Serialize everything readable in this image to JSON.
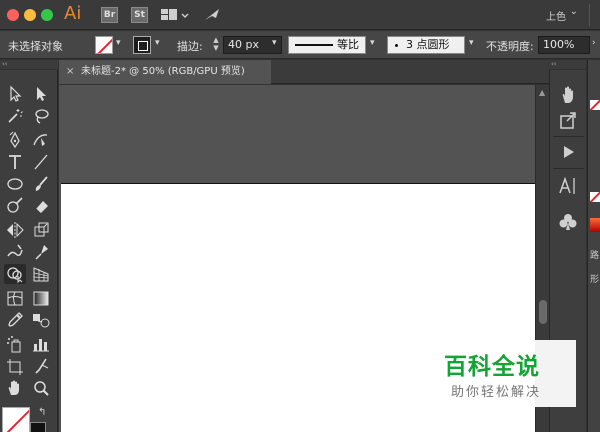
{
  "titlebar": {
    "app_logo": "Ai",
    "bridge_badge": "Br",
    "stock_badge": "St",
    "workspace": "上色",
    "workspace_chevron": "⌄"
  },
  "controlbar": {
    "selection_status": "未选择对象",
    "stroke_label": "描边:",
    "stroke_weight": "40 px",
    "stroke_profile": "等比",
    "brush": "3 点圆形",
    "opacity_label": "不透明度:",
    "opacity": "100%"
  },
  "document": {
    "tab_title": "未标题-2* @ 50% (RGB/GPU 预览)",
    "close_glyph": "×"
  },
  "toolbar": {
    "tools": [
      "selection-tool",
      "direct-selection-tool",
      "magic-wand-tool",
      "lasso-tool",
      "pen-tool",
      "curvature-tool",
      "type-tool",
      "line-segment-tool",
      "ellipse-tool",
      "paintbrush-tool",
      "blob-brush-tool",
      "eraser-tool",
      "reflect-tool",
      "scale-tool",
      "warp-tool",
      "puppet-warp-tool",
      "shape-builder-tool",
      "perspective-grid-tool",
      "mesh-tool",
      "gradient-tool",
      "eyedropper-tool",
      "blend-tool",
      "symbol-sprayer-tool",
      "column-graph-tool",
      "artboard-tool",
      "slice-tool",
      "hand-tool",
      "zoom-tool"
    ],
    "active_tool": "shape-builder-tool",
    "swap_glyph": "↰"
  },
  "dock": {
    "collapse_glyph": "‹‹",
    "buttons": [
      "hand-panel-icon",
      "export-panel-icon",
      "play-actions-icon",
      "character-panel-icon",
      "symbols-panel-icon"
    ]
  },
  "right_strip": {
    "label_1": "路",
    "label_2": "形"
  },
  "watermark": {
    "title": "百科全说",
    "subtitle": "助你轻松解决"
  },
  "colors": {
    "accent_orange": "#e8882c",
    "watermark_green": "#14a335",
    "none_red": "#e0282c"
  }
}
